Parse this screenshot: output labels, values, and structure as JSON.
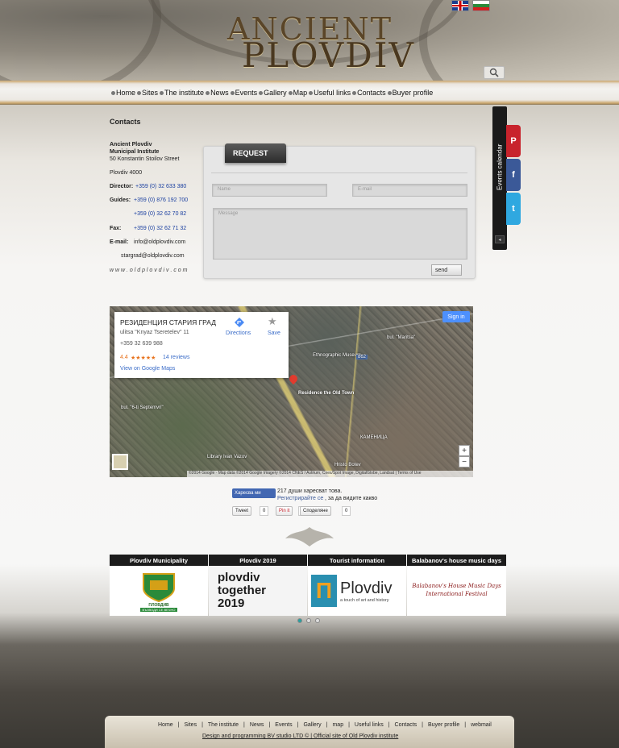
{
  "header": {
    "logo_line1": "ANCIENT",
    "logo_line2": "PLOVDIV",
    "languages": [
      "english-flag-icon",
      "bulgarian-flag-icon"
    ],
    "search_icon": "magnifier-icon"
  },
  "nav": {
    "items": [
      "Home",
      "Sites",
      "The institute",
      "News",
      "Events",
      "Gallery",
      "Map",
      "Useful links",
      "Contacts",
      "Buyer profile"
    ]
  },
  "contacts": {
    "title": "Contacts",
    "org_line1": "Ancient Plovdiv",
    "org_line2": "Municipal Institute",
    "street": "50 Konstantin Stoilov Street",
    "city": "Plovdiv 4000",
    "director_label": "Director:",
    "director_phone": "+359 (0) 32 633 380",
    "guides_label": "Guides:",
    "guides_phone1": "+359 (0) 876 192 700",
    "guides_phone2": "+359 (0) 32 62 70 82",
    "fax_label": "Fax:",
    "fax_phone": "+359 (0) 32 62 71 32",
    "email_label": "E-mail:",
    "email1": "info@oldplovdiv.com",
    "email2": "stargrad@oldplovdiv.com",
    "website": "w w w . o l d p l o v d i v . c o m"
  },
  "request": {
    "tab_label": "REQUEST",
    "name_placeholder": "Name",
    "email_placeholder": "E-mail",
    "message_placeholder": "Message",
    "send_label": "send"
  },
  "events_sidebar": {
    "label": "Events calendar",
    "social": [
      "P",
      "f",
      "t"
    ],
    "arrow": "◂"
  },
  "map": {
    "place_name": "РЕЗИДЕНЦИЯ СТАРИЯ ГРАД",
    "address": "ulitsa \"Knyaz Tseretelev\" 11",
    "phone": "+359 32 639 988",
    "rating": "4.4",
    "stars": "★★★★★",
    "reviews": "14 reviews",
    "view_link": "View on Google Maps",
    "directions": "Directions",
    "save": "Save",
    "signin": "Sign in",
    "pin_label": "Residence the Old Town",
    "museum_label": "Ethnographic Museum",
    "library_label": "Library Ivan Vazov",
    "bus_label": "bul. \"6-ti Septemvri\"",
    "maritsa_label": "bul. \"Maritsa\"",
    "botev_label": "Hristo Botev",
    "kamenitsa_label": "КАМЕНИЦА",
    "road_number": "862",
    "zoom_in": "+",
    "zoom_out": "−",
    "attribution": "©2014 Google · Map data ©2014 Google Imagery ©2014 CNES / Astrium, Cnes/Spot Image, DigitalGlobe, Landsat | Terms of Use"
  },
  "social_plugin": {
    "fb_label": "Харесва ми",
    "fb_text": "217 души харесват това.",
    "fb_register": "Регистрирайте се",
    "fb_register_rest": ", за да видите какво",
    "tweet": "Tweet",
    "tweet_count": "0",
    "pin_it": "Pin it",
    "pin_count": "0",
    "gplus": "Споделяне",
    "gplus_count": "0"
  },
  "partners": [
    {
      "title": "Plovdiv Municipality",
      "img_text": "ПЛОВДИВ",
      "img_sub": "ВЪЗВОДИ СЕ ВЕЧНО"
    },
    {
      "title": "Plovdiv 2019",
      "img_text": "plovdiv together 2019"
    },
    {
      "title": "Tourist information",
      "img_text": "Plovdiv",
      "img_sub": "a touch of art and history"
    },
    {
      "title": "Balabanov's house music days",
      "img_text": "Balabanov's House Music Days International Festival"
    }
  ],
  "footer": {
    "links": [
      "Home",
      "|",
      "Sites",
      "|",
      "The institute",
      "|",
      "News",
      "|",
      "Events",
      "|",
      "Gallery",
      "|",
      "map",
      "|",
      "Useful links",
      "|",
      "Contacts",
      "|",
      "Buyer profile",
      "|",
      "webmail"
    ],
    "credit": "Design and programming BV studio LTD © | Official site of Old Plovdiv institute"
  },
  "colors": {
    "link_blue": "#1a3fa0",
    "nav_gold": "#caa56a",
    "dark_bar": "#1c1c1c"
  }
}
